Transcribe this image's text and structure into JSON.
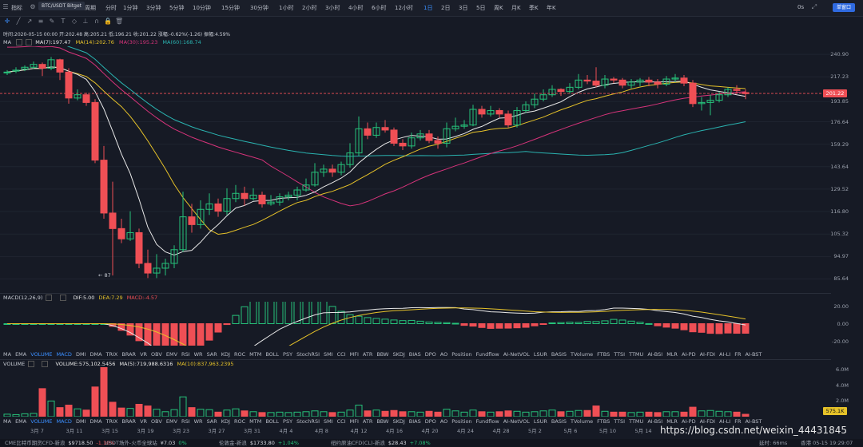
{
  "toolbar": {
    "indicators": "指标",
    "symbol": "BTC/USDT Bitget",
    "period": "周期",
    "timeframes": [
      "分时",
      "1分钟",
      "3分钟",
      "5分钟",
      "10分钟",
      "15分钟",
      "30分钟",
      "1小时",
      "2小时",
      "3小时",
      "4小时",
      "6小时",
      "12小时",
      "1日",
      "2日",
      "3日",
      "5日",
      "周K",
      "月K",
      "季K",
      "年K"
    ],
    "active_timeframe": "1日",
    "right_label": "0s",
    "right_button": "单窗口"
  },
  "info_line": "时间:2020-05-15 00:00  开:202.48  高:205.21  低:196.21  收:201.22  涨幅:-0.62%(-1.26)  振幅:4.59%",
  "ma_legend": {
    "label": "MA",
    "ma7": "MA(7):197.47",
    "ma14": "MA(14):202.76",
    "ma30": "MA(30):195.23",
    "ma60": "MA(60):168.74"
  },
  "price_axis": [
    "240.90",
    "217.23",
    "193.85",
    "176.64",
    "159.29",
    "143.64",
    "129.52",
    "116.80",
    "105.32",
    "94.97",
    "85.64"
  ],
  "current_price": "201.22",
  "low_marker": "87",
  "macd_legend": {
    "label": "MACD(12,26,9)",
    "dif": "DIF:5.00",
    "dea": "DEA:7.29",
    "macd": "MACD:-4.57"
  },
  "macd_axis": [
    "20.00",
    "0.00",
    "-20.00"
  ],
  "indicator_tabs": [
    "MA",
    "EMA",
    "VOLUME",
    "MACD",
    "DMI",
    "DMA",
    "TRIX",
    "BRAR",
    "VR",
    "OBV",
    "EMV",
    "RSI",
    "WR",
    "SAR",
    "KDJ",
    "ROC",
    "MTM",
    "BOLL",
    "PSY",
    "StochRSI",
    "SMI",
    "CCI",
    "MFI",
    "ATR",
    "BBW",
    "SKDJ",
    "BIAS",
    "DPO",
    "AO",
    "Position",
    "Fundflow",
    "AI-NetVOL",
    "LSUR",
    "BASIS",
    "TVolume",
    "FTBS",
    "TTSI",
    "TTMU",
    "AI-BSI",
    "MLR",
    "AI-PD",
    "AI-FDI",
    "AI-LI",
    "FR",
    "AI-BST"
  ],
  "volume_legend": {
    "label": "VOLUME",
    "vol": "VOLUME:575,102.5456",
    "ma5": "MA(5):719,988.6316",
    "ma10": "MA(10):837,963.2395"
  },
  "volume_axis": [
    "6.0M",
    "4.0M",
    "2.0M"
  ],
  "volume_tag": "575.1K",
  "x_axis": [
    "3月 7",
    "3月 11",
    "3月 15",
    "3月 19",
    "3月 23",
    "3月 27",
    "3月 31",
    "4月 4",
    "4月 8",
    "4月 12",
    "4月 16",
    "4月 20",
    "4月 24",
    "4月 28",
    "5月 2",
    "5月 6",
    "5月 10",
    "5月 14"
  ],
  "status_bar": [
    {
      "name": "CME比特币期货CFD-新浪",
      "value": "$9718.50",
      "change": "-1.10%",
      "up": false
    },
    {
      "name": "USDT场外-火币全球站",
      "value": "¥7.03",
      "change": "0%",
      "up": true
    },
    {
      "name": "伦敦金-新浪",
      "value": "$1733.80",
      "change": "+1.04%",
      "up": true
    },
    {
      "name": "纽约原油CFD(CL)-新浪",
      "value": "$28.43",
      "change": "+7.08%",
      "up": true
    }
  ],
  "status_right": {
    "latency": "延时: 66ms",
    "time": "香港 05-15 19:29:07"
  },
  "watermark": "https://blog.csdn.net/weixin_44431845",
  "colors": {
    "up": "#26c27a",
    "down": "#ef4f55",
    "ma7": "#e8e8e8",
    "ma14": "#e6c229",
    "ma30": "#d6337a",
    "ma60": "#2ab3b0",
    "accent": "#3b8fff"
  },
  "chart_data": {
    "type": "candlestick",
    "candles": [
      [
        222,
        222,
        224,
        219
      ],
      [
        223,
        224,
        227,
        221
      ],
      [
        225,
        227,
        229,
        223
      ],
      [
        227,
        230,
        233,
        225
      ],
      [
        230,
        226,
        232,
        218
      ],
      [
        226,
        235,
        238,
        224
      ],
      [
        235,
        222,
        236,
        214
      ],
      [
        222,
        197,
        226,
        192
      ],
      [
        197,
        200,
        205,
        195
      ],
      [
        200,
        193,
        202,
        190
      ],
      [
        193,
        148,
        196,
        146
      ],
      [
        148,
        116,
        158,
        113
      ],
      [
        116,
        108,
        134,
        87
      ],
      [
        108,
        103,
        113,
        101
      ],
      [
        103,
        106,
        117,
        102
      ],
      [
        106,
        92,
        108,
        90
      ],
      [
        92,
        88,
        98,
        86
      ],
      [
        88,
        90,
        96,
        86
      ],
      [
        90,
        92,
        94,
        87
      ],
      [
        92,
        98,
        100,
        90
      ],
      [
        98,
        114,
        128,
        97
      ],
      [
        114,
        110,
        121,
        106
      ],
      [
        110,
        118,
        123,
        108
      ],
      [
        118,
        121,
        127,
        115
      ],
      [
        121,
        117,
        124,
        114
      ],
      [
        117,
        124,
        130,
        115
      ],
      [
        124,
        127,
        132,
        122
      ],
      [
        127,
        124,
        131,
        120
      ],
      [
        124,
        126,
        130,
        123
      ],
      [
        126,
        121,
        128,
        119
      ],
      [
        121,
        122,
        126,
        120
      ],
      [
        122,
        125,
        127,
        120
      ],
      [
        125,
        126,
        128,
        123
      ],
      [
        126,
        129,
        131,
        123
      ],
      [
        129,
        132,
        136,
        128
      ],
      [
        132,
        140,
        146,
        131
      ],
      [
        140,
        142,
        145,
        137
      ],
      [
        142,
        140,
        145,
        137
      ],
      [
        140,
        145,
        147,
        138
      ],
      [
        145,
        153,
        160,
        143
      ],
      [
        153,
        171,
        181,
        151
      ],
      [
        171,
        166,
        176,
        163
      ],
      [
        166,
        172,
        176,
        164
      ],
      [
        172,
        170,
        178,
        168
      ],
      [
        170,
        160,
        172,
        158
      ],
      [
        160,
        158,
        163,
        155
      ],
      [
        158,
        164,
        168,
        156
      ],
      [
        164,
        167,
        170,
        162
      ],
      [
        167,
        162,
        170,
        160
      ],
      [
        162,
        160,
        165,
        156
      ],
      [
        160,
        171,
        176,
        157
      ],
      [
        171,
        173,
        180,
        169
      ],
      [
        173,
        174,
        178,
        171
      ],
      [
        174,
        187,
        191,
        173
      ],
      [
        187,
        183,
        190,
        180
      ],
      [
        183,
        186,
        190,
        181
      ],
      [
        186,
        183,
        188,
        180
      ],
      [
        183,
        174,
        186,
        172
      ],
      [
        174,
        186,
        189,
        172
      ],
      [
        186,
        191,
        194,
        184
      ],
      [
        191,
        196,
        201,
        188
      ],
      [
        196,
        200,
        205,
        194
      ],
      [
        200,
        205,
        209,
        198
      ],
      [
        205,
        203,
        206,
        199
      ],
      [
        203,
        207,
        211,
        201
      ],
      [
        207,
        214,
        220,
        205
      ],
      [
        214,
        213,
        219,
        210
      ],
      [
        213,
        209,
        227,
        207
      ],
      [
        209,
        215,
        219,
        206
      ],
      [
        215,
        214,
        217,
        211
      ],
      [
        214,
        209,
        216,
        206
      ],
      [
        209,
        212,
        215,
        206
      ],
      [
        212,
        214,
        216,
        208
      ],
      [
        214,
        212,
        217,
        208
      ],
      [
        212,
        210,
        215,
        206
      ],
      [
        210,
        215,
        218,
        208
      ],
      [
        215,
        216,
        220,
        212
      ],
      [
        216,
        211,
        219,
        208
      ],
      [
        211,
        192,
        214,
        189
      ],
      [
        192,
        193,
        198,
        186
      ],
      [
        193,
        195,
        200,
        182
      ],
      [
        195,
        200,
        203,
        193
      ],
      [
        200,
        205,
        207,
        198
      ],
      [
        205,
        204,
        209,
        201
      ],
      [
        202,
        201,
        205,
        196
      ]
    ],
    "price_range": [
      80,
      250
    ],
    "volume": [
      0.6,
      0.5,
      0.7,
      0.8,
      6.8,
      3.8,
      2.2,
      2.8,
      1.9,
      1.6,
      7.2,
      12.0,
      3.5,
      2.1,
      2.0,
      3.0,
      2.6,
      1.8,
      1.2,
      1.7,
      4.8,
      2.2,
      1.8,
      1.7,
      1.1,
      1.6,
      1.9,
      1.4,
      1.2,
      1.0,
      1.0,
      1.1,
      1.0,
      1.1,
      1.2,
      1.4,
      1.2,
      1.0,
      1.1,
      1.6,
      2.8,
      1.4,
      1.6,
      1.3,
      1.5,
      1.2,
      1.2,
      1.1,
      1.3,
      1.1,
      1.8,
      1.4,
      1.1,
      1.6,
      1.2,
      1.1,
      1.2,
      1.4,
      1.3,
      1.1,
      1.2,
      1.4,
      1.6,
      1.2,
      1.3,
      1.5,
      1.5,
      2.6,
      1.3,
      1.1,
      1.1,
      1.0,
      1.1,
      1.1,
      1.0,
      1.2,
      1.2,
      1.1,
      2.3,
      1.4,
      1.5,
      1.3,
      1.2,
      1.1,
      0.58
    ],
    "volume_range": [
      0,
      12
    ],
    "macd_range": [
      -25,
      25
    ],
    "series": [
      {
        "name": "MA(7)"
      },
      {
        "name": "MA(14)"
      },
      {
        "name": "MA(30)"
      },
      {
        "name": "MA(60)"
      }
    ]
  }
}
